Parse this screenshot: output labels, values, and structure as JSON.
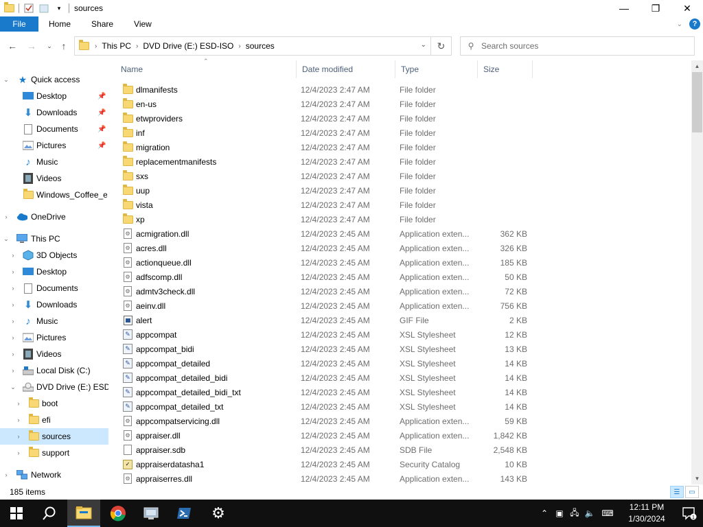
{
  "window": {
    "title": "sources",
    "controls": {
      "minimize": "—",
      "maximize": "❐",
      "close": "✕"
    }
  },
  "ribbon": {
    "tabs": [
      "File",
      "Home",
      "Share",
      "View"
    ],
    "expand_icon": "chevron-down-icon",
    "help": "?"
  },
  "address": {
    "crumbs": [
      "This PC",
      "DVD Drive (E:) ESD-ISO",
      "sources"
    ],
    "search_placeholder": "Search sources"
  },
  "nav": {
    "quick_access": "Quick access",
    "quick_items": [
      {
        "label": "Desktop",
        "icon": "desktop-icon",
        "pinned": true
      },
      {
        "label": "Downloads",
        "icon": "downloads-icon",
        "pinned": true
      },
      {
        "label": "Documents",
        "icon": "documents-icon",
        "pinned": true
      },
      {
        "label": "Pictures",
        "icon": "pictures-icon",
        "pinned": true
      },
      {
        "label": "Music",
        "icon": "music-icon",
        "pinned": false
      },
      {
        "label": "Videos",
        "icon": "videos-icon",
        "pinned": false
      },
      {
        "label": "Windows_Coffee_ec",
        "icon": "folder-icon",
        "pinned": false
      }
    ],
    "onedrive": "OneDrive",
    "this_pc": "This PC",
    "pc_items": [
      {
        "label": "3D Objects",
        "icon": "3d-objects-icon"
      },
      {
        "label": "Desktop",
        "icon": "desktop-icon"
      },
      {
        "label": "Documents",
        "icon": "documents-icon"
      },
      {
        "label": "Downloads",
        "icon": "downloads-icon"
      },
      {
        "label": "Music",
        "icon": "music-icon"
      },
      {
        "label": "Pictures",
        "icon": "pictures-icon"
      },
      {
        "label": "Videos",
        "icon": "videos-icon"
      },
      {
        "label": "Local Disk (C:)",
        "icon": "local-disk-icon"
      },
      {
        "label": "DVD Drive (E:) ESD-I",
        "icon": "dvd-drive-icon"
      }
    ],
    "dvd_children": [
      "boot",
      "efi",
      "sources",
      "support"
    ],
    "selected": "sources",
    "network": "Network"
  },
  "list": {
    "columns": [
      "Name",
      "Date modified",
      "Type",
      "Size"
    ],
    "files": [
      {
        "name": "dlmanifests",
        "date": "12/4/2023 2:47 AM",
        "type": "File folder",
        "size": "",
        "icon": "folder"
      },
      {
        "name": "en-us",
        "date": "12/4/2023 2:47 AM",
        "type": "File folder",
        "size": "",
        "icon": "folder"
      },
      {
        "name": "etwproviders",
        "date": "12/4/2023 2:47 AM",
        "type": "File folder",
        "size": "",
        "icon": "folder"
      },
      {
        "name": "inf",
        "date": "12/4/2023 2:47 AM",
        "type": "File folder",
        "size": "",
        "icon": "folder"
      },
      {
        "name": "migration",
        "date": "12/4/2023 2:47 AM",
        "type": "File folder",
        "size": "",
        "icon": "folder"
      },
      {
        "name": "replacementmanifests",
        "date": "12/4/2023 2:47 AM",
        "type": "File folder",
        "size": "",
        "icon": "folder"
      },
      {
        "name": "sxs",
        "date": "12/4/2023 2:47 AM",
        "type": "File folder",
        "size": "",
        "icon": "folder"
      },
      {
        "name": "uup",
        "date": "12/4/2023 2:47 AM",
        "type": "File folder",
        "size": "",
        "icon": "folder"
      },
      {
        "name": "vista",
        "date": "12/4/2023 2:47 AM",
        "type": "File folder",
        "size": "",
        "icon": "folder"
      },
      {
        "name": "xp",
        "date": "12/4/2023 2:47 AM",
        "type": "File folder",
        "size": "",
        "icon": "folder"
      },
      {
        "name": "acmigration.dll",
        "date": "12/4/2023 2:45 AM",
        "type": "Application exten...",
        "size": "362 KB",
        "icon": "dll"
      },
      {
        "name": "acres.dll",
        "date": "12/4/2023 2:45 AM",
        "type": "Application exten...",
        "size": "326 KB",
        "icon": "dll"
      },
      {
        "name": "actionqueue.dll",
        "date": "12/4/2023 2:45 AM",
        "type": "Application exten...",
        "size": "185 KB",
        "icon": "dll"
      },
      {
        "name": "adfscomp.dll",
        "date": "12/4/2023 2:45 AM",
        "type": "Application exten...",
        "size": "50 KB",
        "icon": "dll"
      },
      {
        "name": "admtv3check.dll",
        "date": "12/4/2023 2:45 AM",
        "type": "Application exten...",
        "size": "72 KB",
        "icon": "dll"
      },
      {
        "name": "aeinv.dll",
        "date": "12/4/2023 2:45 AM",
        "type": "Application exten...",
        "size": "756 KB",
        "icon": "dll"
      },
      {
        "name": "alert",
        "date": "12/4/2023 2:45 AM",
        "type": "GIF File",
        "size": "2 KB",
        "icon": "gif"
      },
      {
        "name": "appcompat",
        "date": "12/4/2023 2:45 AM",
        "type": "XSL Stylesheet",
        "size": "12 KB",
        "icon": "xsl"
      },
      {
        "name": "appcompat_bidi",
        "date": "12/4/2023 2:45 AM",
        "type": "XSL Stylesheet",
        "size": "13 KB",
        "icon": "xsl"
      },
      {
        "name": "appcompat_detailed",
        "date": "12/4/2023 2:45 AM",
        "type": "XSL Stylesheet",
        "size": "14 KB",
        "icon": "xsl"
      },
      {
        "name": "appcompat_detailed_bidi",
        "date": "12/4/2023 2:45 AM",
        "type": "XSL Stylesheet",
        "size": "14 KB",
        "icon": "xsl"
      },
      {
        "name": "appcompat_detailed_bidi_txt",
        "date": "12/4/2023 2:45 AM",
        "type": "XSL Stylesheet",
        "size": "14 KB",
        "icon": "xsl"
      },
      {
        "name": "appcompat_detailed_txt",
        "date": "12/4/2023 2:45 AM",
        "type": "XSL Stylesheet",
        "size": "14 KB",
        "icon": "xsl"
      },
      {
        "name": "appcompatservicing.dll",
        "date": "12/4/2023 2:45 AM",
        "type": "Application exten...",
        "size": "59 KB",
        "icon": "dll"
      },
      {
        "name": "appraiser.dll",
        "date": "12/4/2023 2:45 AM",
        "type": "Application exten...",
        "size": "1,842 KB",
        "icon": "dll"
      },
      {
        "name": "appraiser.sdb",
        "date": "12/4/2023 2:45 AM",
        "type": "SDB File",
        "size": "2,548 KB",
        "icon": "doc"
      },
      {
        "name": "appraiserdatasha1",
        "date": "12/4/2023 2:45 AM",
        "type": "Security Catalog",
        "size": "10 KB",
        "icon": "cat"
      },
      {
        "name": "appraiserres.dll",
        "date": "12/4/2023 2:45 AM",
        "type": "Application exten...",
        "size": "143 KB",
        "icon": "dll"
      }
    ]
  },
  "status": {
    "items": "185 items"
  },
  "taskbar": {
    "apps": [
      "start-icon",
      "search-icon",
      "file-explorer-icon",
      "chrome-icon",
      "network-app-icon",
      "powershell-icon",
      "settings-icon"
    ],
    "time": "12:11 PM",
    "date": "1/30/2024",
    "notification_count": "1"
  },
  "colors": {
    "accent": "#1979ca",
    "selection": "#cce8ff",
    "folder": "#f8d775"
  }
}
